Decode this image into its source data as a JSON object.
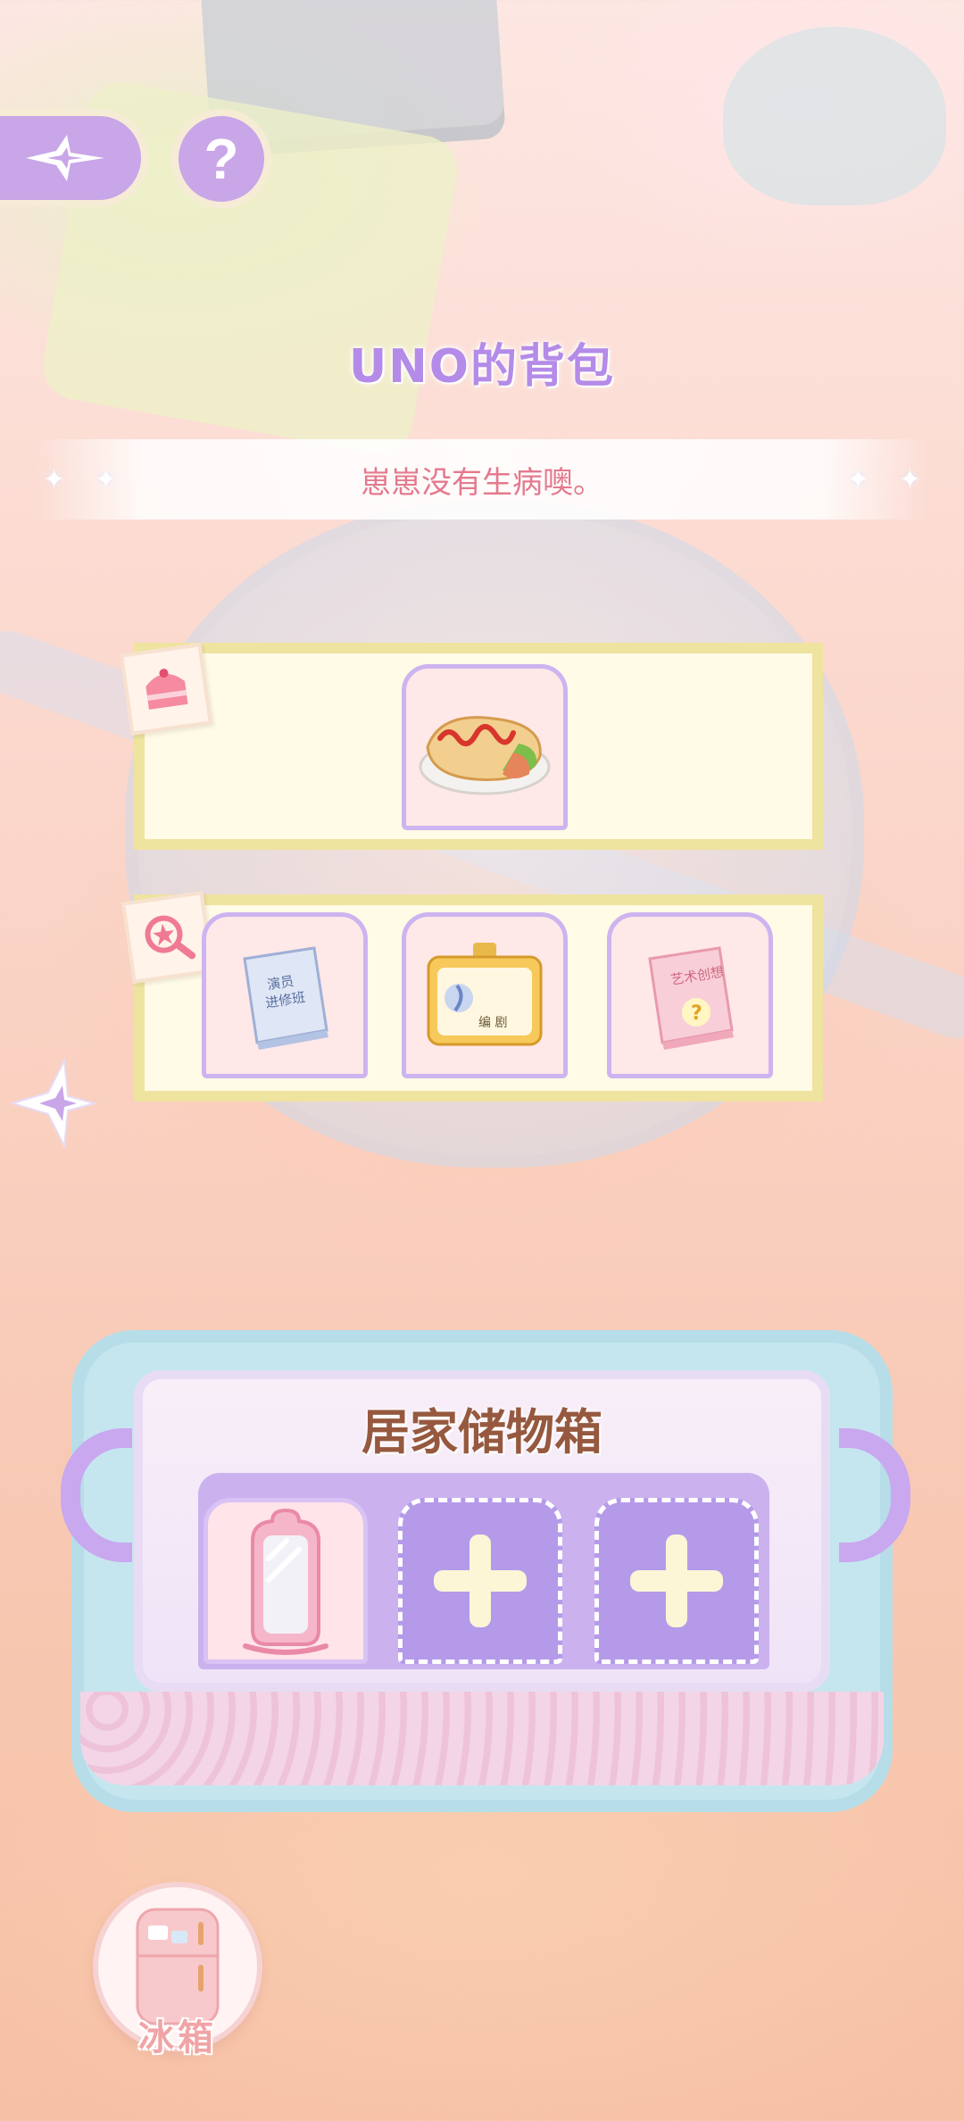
{
  "header": {
    "back_icon": "four-point-star-arrow-icon",
    "help_label": "?",
    "title": "UNO的背包"
  },
  "message": "崽崽没有生病噢。",
  "backpack": {
    "food_row": {
      "tag_icon": "cake-icon",
      "items": [
        {
          "icon": "hotdog-plate-icon"
        }
      ]
    },
    "item_row": {
      "tag_icon": "magnifier-star-icon",
      "items": [
        {
          "icon": "book-icon",
          "text": "演员进修班"
        },
        {
          "icon": "id-card-icon",
          "text": "编 剧"
        },
        {
          "icon": "book-icon",
          "text": "艺术创想"
        }
      ]
    }
  },
  "side_nav": {
    "icon": "four-point-star-arrow-icon"
  },
  "storage": {
    "title": "居家储物箱",
    "slots": [
      {
        "state": "filled",
        "icon": "pink-mirror-icon"
      },
      {
        "state": "empty",
        "icon": "plus-icon"
      },
      {
        "state": "empty",
        "icon": "plus-icon"
      }
    ]
  },
  "fridge": {
    "label": "冰箱",
    "icon": "fridge-icon"
  },
  "colors": {
    "accent_purple": "#c8a6e8",
    "title_purple": "#b48be8",
    "message_pink": "#e37a8e",
    "storage_title_brown": "#96593f"
  }
}
